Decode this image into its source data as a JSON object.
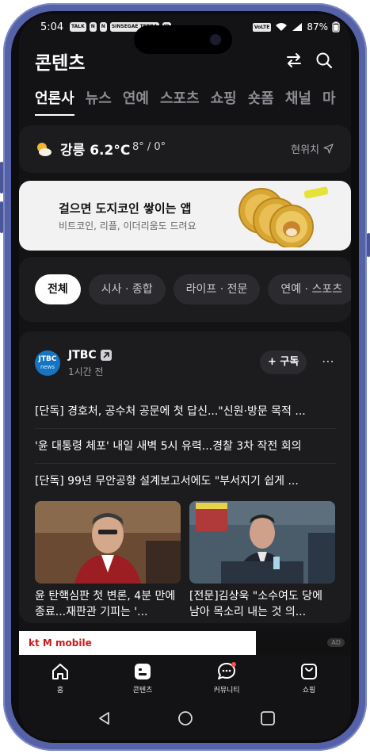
{
  "status_bar": {
    "time": "5:04",
    "notification_labels": [
      "TALK",
      "N",
      "N",
      "SINSEGAE TERRA",
      "ID"
    ],
    "battery": "87%",
    "right_badge": "VoLTE"
  },
  "header": {
    "title": "콘텐츠"
  },
  "tabs": [
    {
      "label": "언론사"
    },
    {
      "label": "뉴스"
    },
    {
      "label": "연예"
    },
    {
      "label": "스포츠"
    },
    {
      "label": "쇼핑"
    },
    {
      "label": "숏폼"
    },
    {
      "label": "채널"
    },
    {
      "label": "마"
    }
  ],
  "weather": {
    "city_temp": "강릉 6.2°C",
    "range": "8° / 0°",
    "location_label": "현위치"
  },
  "ad_banner": {
    "headline": "걸으면 도지코인 쌓이는 앱",
    "subtext": "비트코인, 리플, 이더리움도 드려요"
  },
  "filters": [
    {
      "label": "전체"
    },
    {
      "label": "시사 · 종합"
    },
    {
      "label": "라이프 · 전문"
    },
    {
      "label": "연예 · 스포츠"
    }
  ],
  "publisher": {
    "logo_top": "JTBC",
    "logo_bottom": "news",
    "name": "JTBC",
    "time": "1시간 전",
    "follow_label": "+ 구독"
  },
  "headlines": [
    "[단독] 경호처, 공수처 공문에 첫 답신...\"신원·방문 목적 ...",
    "'윤 대통령 체포' 내일 새벽 5시 유력...경찰 3차 작전 회의",
    "[단독] 99년 무안공항 설계보고서에도 \"부서지기 쉽게 ..."
  ],
  "thumbnails": [
    {
      "caption": "윤 탄핵심판 첫 변론, 4분 만에 종료...재판관 기피는 '..."
    },
    {
      "caption": "[전문]김상욱 \"소수여도 당에 남아 목소리 내는 것 의..."
    }
  ],
  "bottom_ad": {
    "brand": "kt M mobile",
    "badge": "AD"
  },
  "bottom_nav": [
    {
      "label": "홈",
      "icon": "home-icon"
    },
    {
      "label": "콘텐츠",
      "icon": "content-icon"
    },
    {
      "label": "커뮤니티",
      "icon": "chat-bubble-icon"
    },
    {
      "label": "쇼핑",
      "icon": "shopping-bag-icon"
    }
  ],
  "colors": {
    "background": "#131315",
    "card": "#1c1c1f",
    "frame": "#5662a8",
    "notification_dot": "#ff4d4d"
  }
}
